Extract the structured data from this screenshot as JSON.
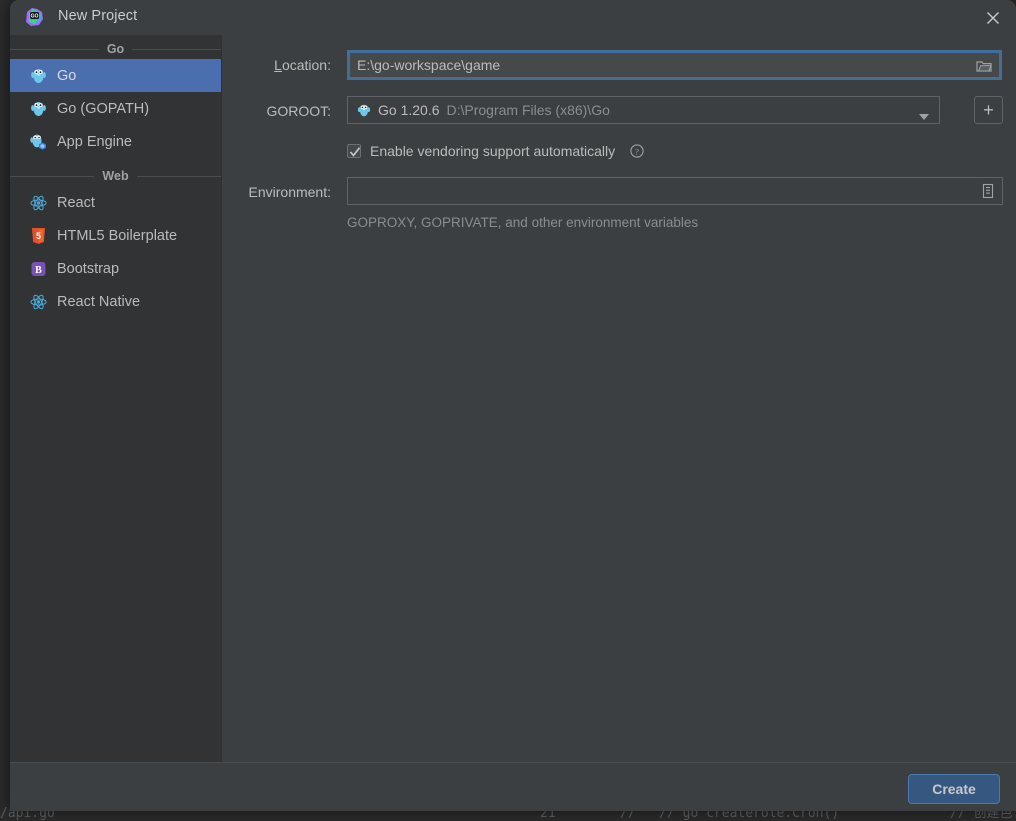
{
  "window": {
    "title": "New Project",
    "app_icon": "goland-icon",
    "close_label": "×"
  },
  "sidebar": {
    "groups": [
      {
        "label": "Go",
        "items": [
          {
            "label": "Go",
            "icon": "go-gopher-icon",
            "selected": true
          },
          {
            "label": "Go (GOPATH)",
            "icon": "go-gopher-icon",
            "selected": false
          },
          {
            "label": "App Engine",
            "icon": "app-engine-icon",
            "selected": false
          }
        ]
      },
      {
        "label": "Web",
        "items": [
          {
            "label": "React",
            "icon": "react-icon",
            "selected": false
          },
          {
            "label": "HTML5 Boilerplate",
            "icon": "html5-icon",
            "selected": false
          },
          {
            "label": "Bootstrap",
            "icon": "bootstrap-icon",
            "selected": false
          },
          {
            "label": "React Native",
            "icon": "react-icon",
            "selected": false
          }
        ]
      }
    ]
  },
  "form": {
    "location": {
      "label_prefix": "L",
      "label_rest": "ocation:",
      "value": "E:\\go-workspace\\game",
      "browse_icon": "folder-icon"
    },
    "goroot": {
      "label": "GOROOT:",
      "icon": "go-gopher-icon",
      "value": "Go 1.20.6",
      "path": "D:\\Program Files (x86)\\Go",
      "dropdown_icon": "chevron-down-icon",
      "add_button_label": "+"
    },
    "vendoring": {
      "label": "Enable vendoring support automatically",
      "checked": true,
      "help_icon": "help-circle-icon"
    },
    "environment": {
      "label": "Environment:",
      "value": "",
      "placeholder": "",
      "edit_icon": "list-edit-icon",
      "hint": "GOPROXY, GOPRIVATE, and other environment variables"
    }
  },
  "footer": {
    "create_label": "Create"
  },
  "background": {
    "code_left": "/api.go",
    "code_line_number": "21",
    "code_middle": "//   // go createrole.Cron()",
    "code_right": "// 创建色."
  },
  "colors": {
    "dialog_bg": "#3c3f41",
    "sidebar_bg": "#313335",
    "selection": "#4b6eaf",
    "accent_button": "#365880",
    "focus_border": "#3b6ea8",
    "text": "#bbbbbb",
    "dim_text": "#8a8d8f"
  }
}
